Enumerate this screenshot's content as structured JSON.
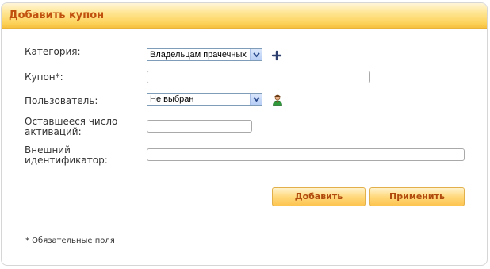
{
  "header": {
    "title": "Добавить купон"
  },
  "form": {
    "category": {
      "label": "Категория:",
      "value": "Владельцам прачечных"
    },
    "coupon": {
      "label": "Купон*:",
      "value": ""
    },
    "user": {
      "label": "Пользователь:",
      "value": "Не выбран"
    },
    "remaining": {
      "label_line1": "Оставшееся число",
      "label_line2": "активаций:",
      "value": ""
    },
    "external_id": {
      "label_line1": "Внешний",
      "label_line2": "идентификатор:",
      "value": ""
    }
  },
  "buttons": {
    "add_label": "Добавить",
    "apply_label": "Применить"
  },
  "footnote": "* Обязательные поля",
  "icons": {
    "add_category": "plus-icon",
    "select_user": "user-icon",
    "dropdown": "chevron-down-icon"
  },
  "colors": {
    "title": "#c0500e",
    "header_gradient_top": "#fff6d8",
    "header_gradient_bottom": "#f7c140",
    "button_text": "#b04a0d",
    "button_border": "#e2b04a"
  }
}
